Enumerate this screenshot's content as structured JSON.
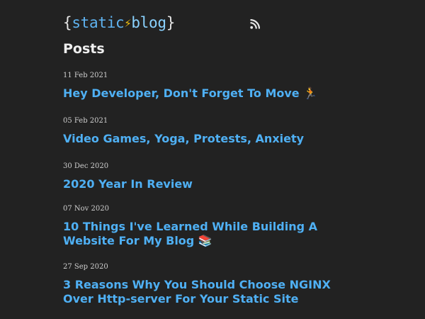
{
  "site": {
    "logo_open_brace": "{",
    "logo_word1": "static",
    "logo_bolt": "⚡",
    "logo_word2": "blog",
    "logo_close_brace": "}",
    "rss_icon": "rss-icon"
  },
  "page_title": "Posts",
  "posts": [
    {
      "date": "11 Feb 2021",
      "title": "Hey Developer, Don't Forget To Move 🏃"
    },
    {
      "date": "05 Feb 2021",
      "title": "Video Games, Yoga, Protests, Anxiety"
    },
    {
      "date": "30 Dec 2020",
      "title": "2020 Year In Review"
    },
    {
      "date": "07 Nov 2020",
      "title": "10 Things I've Learned While Building A Website For My Blog 📚"
    },
    {
      "date": "27 Sep 2020",
      "title": "3 Reasons Why You Should Choose NGINX Over Http-server For Your Static Site"
    }
  ],
  "colors": {
    "background": "#222222",
    "link": "#4fb0f4",
    "text": "#e6e6e6",
    "accent_bolt": "#f4c20d"
  }
}
